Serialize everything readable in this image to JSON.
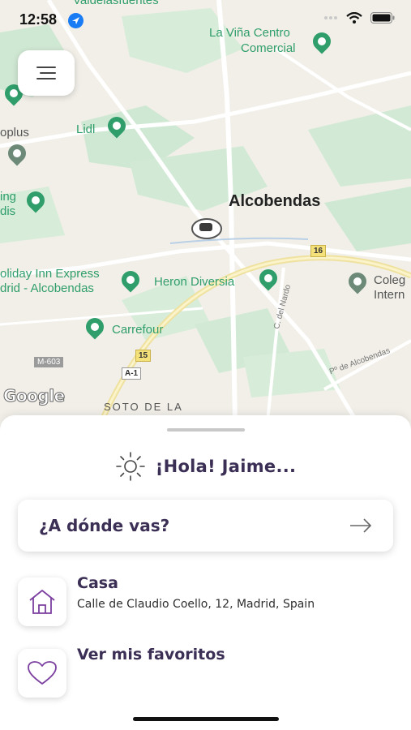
{
  "status_bar": {
    "time": "12:58"
  },
  "map": {
    "city": "Alcobendas",
    "places": {
      "la_vina_line1": "La Viña Centro",
      "la_vina_line2": "Comercial",
      "lidl": "Lidl",
      "holiday_line1": "oliday Inn Express",
      "holiday_line2": "drid - Alcobendas",
      "heron": "Heron Diversia",
      "carrefour": "Carrefour",
      "colegio_line1": "Coleg",
      "colegio_line2": "Intern",
      "plus": "oplus",
      "ing_line1": "ing",
      "ing_line2": "dis",
      "top": "Valdelasfuentes"
    },
    "roads": {
      "m16": "16",
      "m15": "15",
      "a1": "A-1",
      "m603": "M-603",
      "nardo": "C. del Nardo",
      "paseo": "Pº de Alcobendas"
    },
    "district": "SOTO DE LA",
    "attribution": "Google"
  },
  "sheet": {
    "greeting": "¡Hola! Jaime...",
    "search_label": "¿A dónde vas?",
    "home_title": "Casa",
    "home_address": "Calle de Claudio Coello, 12, Madrid, Spain",
    "favorites_label": "Ver mis favoritos"
  },
  "colors": {
    "accent": "#7b3fa0",
    "text": "#3b2f55",
    "map_green": "#2f9e6a"
  }
}
